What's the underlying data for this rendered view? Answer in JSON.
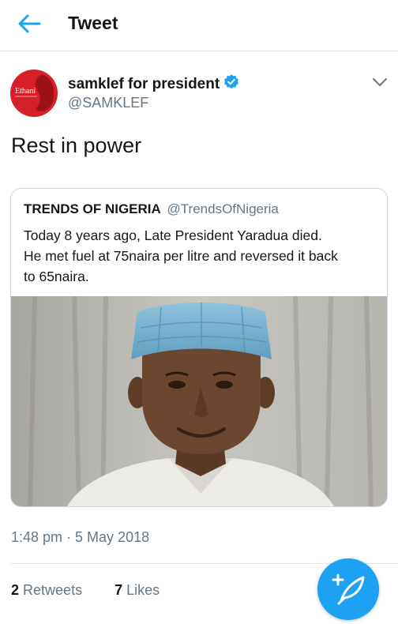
{
  "header": {
    "title": "Tweet",
    "back_icon": "arrow-left-icon"
  },
  "tweet": {
    "author_name": "samklef for president",
    "author_handle": "@SAMKLEF",
    "avatar_text": "Ethani",
    "text": "Rest in power",
    "timestamp": "1:48 pm · 5 May 2018"
  },
  "quote": {
    "name": "TRENDS OF NIGERIA",
    "handle": "@TrendsOfNigeria",
    "lines": [
      "Today 8 years ago, Late President Yaradua died.",
      "He met fuel at 75naira per litre and  reversed it back",
      "to 65naira."
    ]
  },
  "stats": {
    "retweets_count": "2",
    "retweets_label": "Retweets",
    "likes_count": "7",
    "likes_label": "Likes"
  },
  "colors": {
    "accent": "#1da1f2",
    "secondary_text": "#657786",
    "avatar_bg": "#d61f26"
  }
}
